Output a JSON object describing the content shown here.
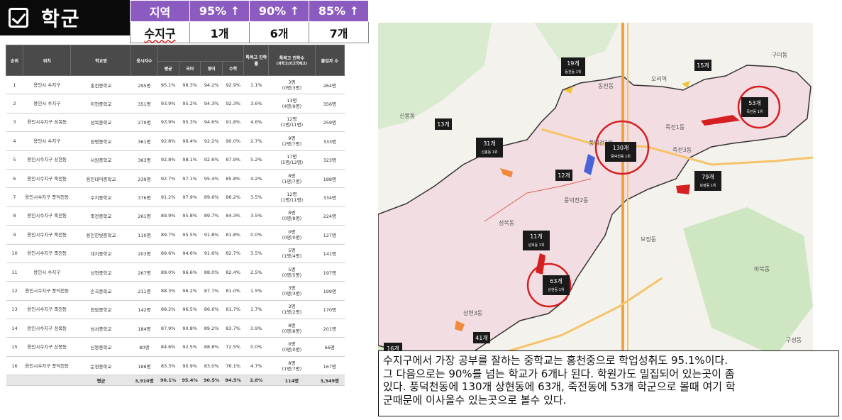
{
  "header": {
    "title": "학군",
    "summary": {
      "headers": [
        "지역",
        "95% ↑",
        "90% ↑",
        "85% ↑"
      ],
      "values": [
        "수지구",
        "1개",
        "6개",
        "7개"
      ]
    }
  },
  "table": {
    "columns": {
      "rank": "순위",
      "location": "위치",
      "school": "학교명",
      "students": "응시자수",
      "group_top": "",
      "avg": "평균",
      "kor": "국어",
      "eng": "영어",
      "math": "수학",
      "special_rate": "특목고 진학률",
      "special_count": "특목고 진학수",
      "special_detail": "(과학고/외고국제고)",
      "grads": "졸업자 수"
    },
    "rows": [
      {
        "rank": "1",
        "location": "용인시 수지구",
        "school": "홍천중학교",
        "students": "295명",
        "avg": "95.1%",
        "kor": "98.3%",
        "eng": "94.2%",
        "math": "92.9%",
        "special_rate": "1.1%",
        "special_count": "3명",
        "special_detail": "(0명/3명)",
        "grads": "264명"
      },
      {
        "rank": "2",
        "location": "용인시 수지구",
        "school": "이현중학교",
        "students": "351명",
        "avg": "93.9%",
        "kor": "95.2%",
        "eng": "94.3%",
        "math": "92.3%",
        "special_rate": "3.6%",
        "special_count": "13명",
        "special_detail": "(4명/9명)",
        "grads": "356명"
      },
      {
        "rank": "3",
        "location": "용인시수지구 성복동",
        "school": "성복중학교",
        "students": "279명",
        "avg": "93.9%",
        "kor": "95.3%",
        "eng": "94.6%",
        "math": "91.8%",
        "special_rate": "4.6%",
        "special_count": "12명",
        "special_detail": "(1명/11명)",
        "grads": "259명"
      },
      {
        "rank": "4",
        "location": "용인시 수지구",
        "school": "정평중학교",
        "students": "361명",
        "avg": "92.8%",
        "kor": "96.4%",
        "eng": "92.2%",
        "math": "90.0%",
        "special_rate": "2.7%",
        "special_count": "9명",
        "special_detail": "(2명/7명)",
        "grads": "333명"
      },
      {
        "rank": "5",
        "location": "용인시수지구 상현동",
        "school": "서원중학교",
        "students": "363명",
        "avg": "92.8%",
        "kor": "98.1%",
        "eng": "92.6%",
        "math": "87.9%",
        "special_rate": "5.2%",
        "special_count": "17명",
        "special_detail": "(5명/12명)",
        "grads": "323명"
      },
      {
        "rank": "6",
        "location": "용인시수지구 죽전동",
        "school": "용인대덕중학교",
        "students": "239명",
        "avg": "92.7%",
        "kor": "97.1%",
        "eng": "95.4%",
        "math": "85.8%",
        "special_rate": "4.2%",
        "special_count": "8명",
        "special_detail": "(1명/7명)",
        "grads": "188명"
      },
      {
        "rank": "7",
        "location": "용인시수지구 풍덕천동",
        "school": "수지중학교",
        "students": "376명",
        "avg": "91.2%",
        "kor": "97.9%",
        "eng": "89.6%",
        "math": "86.2%",
        "special_rate": "3.5%",
        "special_count": "12명",
        "special_detail": "(1명/11명)",
        "grads": "334명"
      },
      {
        "rank": "8",
        "location": "용인시수지구 죽전동",
        "school": "죽전중학교",
        "students": "261명",
        "avg": "89.9%",
        "kor": "95.8%",
        "eng": "89.7%",
        "math": "84.3%",
        "special_rate": "3.5%",
        "special_count": "8명",
        "special_detail": "(0명/8명)",
        "grads": "224명"
      },
      {
        "rank": "9",
        "location": "용인시수지구 죽전동",
        "school": "용인한빛중학교",
        "students": "110명",
        "avg": "89.7%",
        "kor": "95.5%",
        "eng": "91.8%",
        "math": "81.8%",
        "special_rate": "0.0%",
        "special_count": "0명",
        "special_detail": "(0명/0명)",
        "grads": "127명"
      },
      {
        "rank": "10",
        "location": "용인시수지구 죽전동",
        "school": "대지중학교",
        "students": "203명",
        "avg": "89.6%",
        "kor": "94.6%",
        "eng": "91.6%",
        "math": "82.7%",
        "special_rate": "3.5%",
        "special_count": "5명",
        "special_detail": "(1명/4명)",
        "grads": "141명"
      },
      {
        "rank": "11",
        "location": "용인시 수지구",
        "school": "상현중학교",
        "students": "267명",
        "avg": "89.0%",
        "kor": "96.6%",
        "eng": "88.0%",
        "math": "82.4%",
        "special_rate": "2.5%",
        "special_count": "5명",
        "special_detail": "(0명/5명)",
        "grads": "197명"
      },
      {
        "rank": "12",
        "location": "용인시수지구 풍덕천동",
        "school": "손곡중학교",
        "students": "211명",
        "avg": "88.3%",
        "kor": "96.2%",
        "eng": "87.7%",
        "math": "81.0%",
        "special_rate": "1.5%",
        "special_count": "3명",
        "special_detail": "(0명/3명)",
        "grads": "199명"
      },
      {
        "rank": "13",
        "location": "용인시수지구 죽전동",
        "school": "현암중학교",
        "students": "142명",
        "avg": "88.2%",
        "kor": "96.5%",
        "eng": "86.6%",
        "math": "81.7%",
        "special_rate": "1.7%",
        "special_count": "3명",
        "special_detail": "(1명/2명)",
        "grads": "170명"
      },
      {
        "rank": "14",
        "location": "용인시수지구 성복동",
        "school": "성서중학교",
        "students": "184명",
        "avg": "87.9%",
        "kor": "90.8%",
        "eng": "89.2%",
        "math": "83.7%",
        "special_rate": "3.9%",
        "special_count": "8명",
        "special_detail": "(0명/8명)",
        "grads": "201명"
      },
      {
        "rank": "15",
        "location": "용인시수지구 신봉동",
        "school": "신봉중학교",
        "students": "80명",
        "avg": "84.6%",
        "kor": "92.5%",
        "eng": "88.8%",
        "math": "72.5%",
        "special_rate": "0.0%",
        "special_count": "0명",
        "special_detail": "(0명/0명)",
        "grads": "66명"
      },
      {
        "rank": "16",
        "location": "용인시수지구 풍덕천동",
        "school": "문정중학교",
        "students": "188명",
        "avg": "83.3%",
        "kor": "90.9%",
        "eng": "83.0%",
        "math": "76.1%",
        "special_rate": "4.7%",
        "special_count": "8명",
        "special_detail": "(1명/7명)",
        "grads": "167명"
      }
    ],
    "footer": {
      "label": "평균",
      "students": "3,910명",
      "avg": "90.1%",
      "kor": "95.4%",
      "eng": "90.5%",
      "math": "84.5%",
      "special_rate": "2.8%",
      "special_count": "114명",
      "grads": "3,549명"
    }
  },
  "map": {
    "labels": [
      {
        "count": "19개",
        "sub": "동천동 1위"
      },
      {
        "count": "15개",
        "sub": ""
      },
      {
        "count": "53개",
        "sub": "죽전동 1위"
      },
      {
        "count": "13개",
        "sub": ""
      },
      {
        "count": "31개",
        "sub": "신봉동 1위"
      },
      {
        "count": "130개",
        "sub": "풍덕천동 1위"
      },
      {
        "count": "12개",
        "sub": ""
      },
      {
        "count": "79개",
        "sub": "보정동 1위"
      },
      {
        "count": "11개",
        "sub": "성복동 1위"
      },
      {
        "count": "63개",
        "sub": "상현동 1위"
      },
      {
        "count": "41개",
        "sub": ""
      },
      {
        "count": "16개",
        "sub": ""
      }
    ],
    "places": [
      "죽전1동",
      "죽전3동",
      "풍덕천1동",
      "풍덕천2동",
      "성복동",
      "상현3동",
      "보정동",
      "동천동",
      "신봉동",
      "오리역",
      "구성동",
      "마북동",
      "구미동"
    ]
  },
  "comment": {
    "lines": [
      "수지구에서 가장 공부를 잘하는 중학교는 홍천중으로 학업성취도 95.1%이다.",
      "그 다음으로는 90%를 넘는 학교가 6개나 된다. 학원가도 밀집되어 있는곳이 좀",
      "있다. 풍덕천동에 130개 상현동에 63개, 죽전동에 53개 학군으로 볼때 여기 학",
      "군때문에 이사올수 있는곳으로 볼수 있다."
    ]
  },
  "colors": {
    "accent_purple": "#8c5bbf",
    "header_black": "#0a0a0a",
    "district_pink": "#f2dde3",
    "highlight_red": "#d62020",
    "map_park_green": "#cfe6c2"
  }
}
